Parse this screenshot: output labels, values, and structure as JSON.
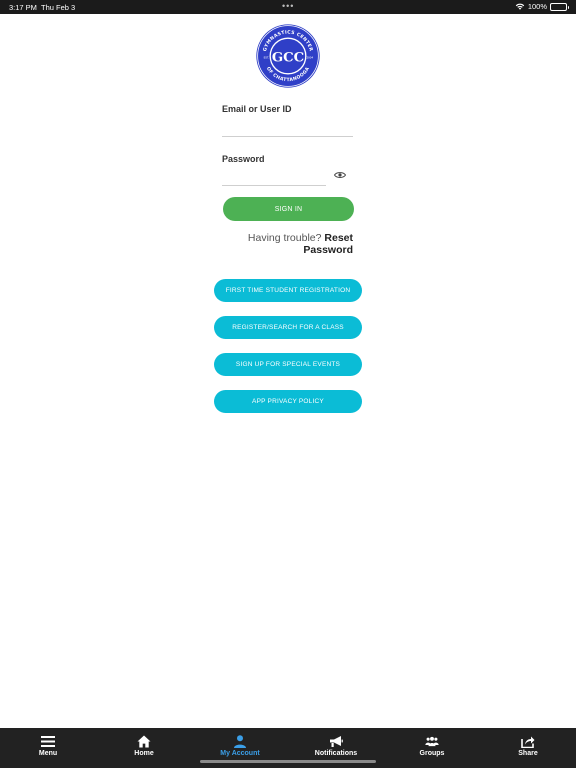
{
  "status_bar": {
    "time": "3:17 PM",
    "date": "Thu Feb 3",
    "dots": "•••",
    "battery": "100%"
  },
  "logo": {
    "initials": "GCC",
    "ring_text_top": "GYMNASTICS CENTER",
    "ring_text_bottom": "OF CHATTANOOGA",
    "est_label": "EST.",
    "est_year": "2004",
    "brand_color": "#2f3fc7"
  },
  "form": {
    "email_label": "Email or User ID",
    "email_value": "",
    "password_label": "Password",
    "password_value": "",
    "signin_label": "SIGN IN",
    "trouble_text": "Having trouble?",
    "reset_label": "Reset Password"
  },
  "actions": [
    {
      "label": "FIRST TIME STUDENT REGISTRATION"
    },
    {
      "label": "REGISTER/SEARCH FOR A CLASS"
    },
    {
      "label": "SIGN UP FOR SPECIAL EVENTS"
    },
    {
      "label": "APP PRIVACY POLICY"
    }
  ],
  "tabs": [
    {
      "label": "Menu",
      "icon": "menu-icon"
    },
    {
      "label": "Home",
      "icon": "home-icon"
    },
    {
      "label": "My Account",
      "icon": "user-icon"
    },
    {
      "label": "Notifications",
      "icon": "megaphone-icon"
    },
    {
      "label": "Groups",
      "icon": "groups-icon"
    },
    {
      "label": "Share",
      "icon": "share-icon"
    }
  ],
  "colors": {
    "signin_green": "#4db154",
    "action_cyan": "#0bbcd6",
    "tab_active_blue": "#3b9fe8",
    "tab_bar_bg": "#222222"
  }
}
